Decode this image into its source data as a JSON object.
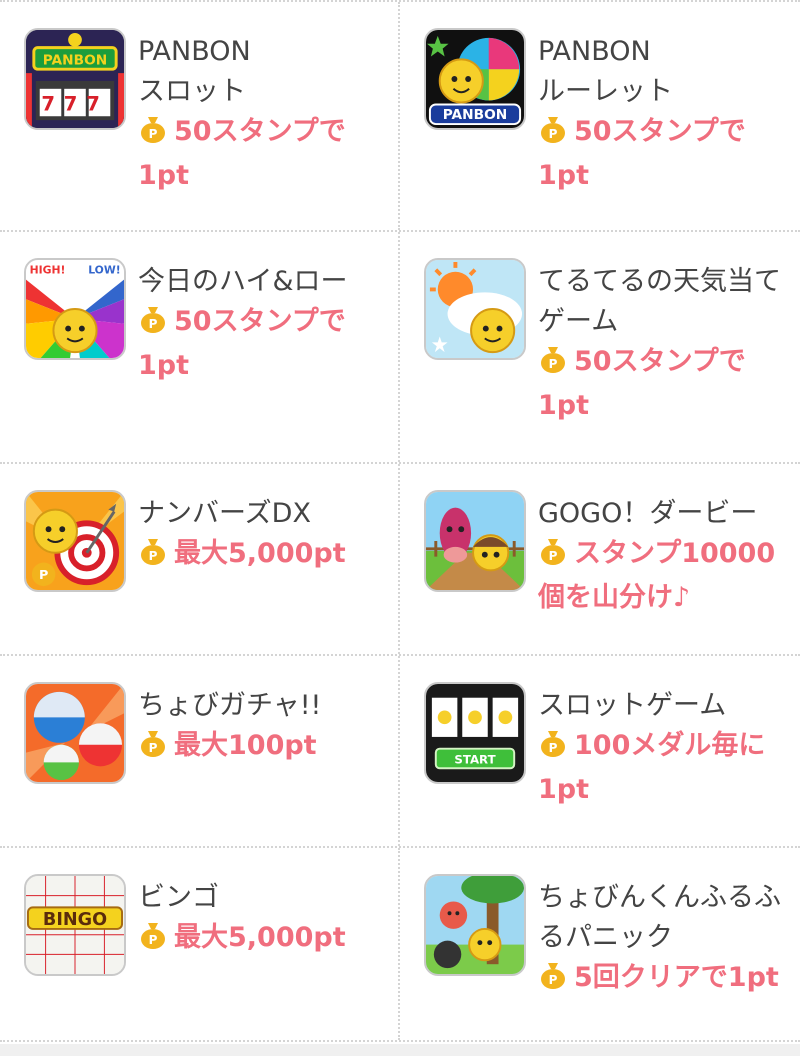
{
  "colors": {
    "title": "#444444",
    "reward": "#f06e7e",
    "bag": "#f2b31d"
  },
  "games": [
    {
      "title": "PANBON\nスロット",
      "reward": "50スタンプで1pt",
      "icon": "panbon-slot-icon"
    },
    {
      "title": "PANBON\nルーレット",
      "reward": "50スタンプで1pt",
      "icon": "panbon-roulette-icon"
    },
    {
      "title": "今日のハイ&ロー",
      "reward": "50スタンプで1pt",
      "icon": "high-low-icon"
    },
    {
      "title": "てるてるの天気当てゲーム",
      "reward": "50スタンプで1pt",
      "icon": "weather-game-icon"
    },
    {
      "title": "ナンバーズDX",
      "reward": "最大5,000pt",
      "icon": "numbers-dx-icon"
    },
    {
      "title": "GOGO！ダービー",
      "reward": "スタンプ10000個を山分け♪",
      "icon": "derby-icon"
    },
    {
      "title": "ちょびガチャ!!",
      "reward": "最大100pt",
      "icon": "gacha-icon"
    },
    {
      "title": "スロットゲーム",
      "reward": "100メダル毎に1pt",
      "icon": "slot-game-icon"
    },
    {
      "title": "ビンゴ",
      "reward": "最大5,000pt",
      "icon": "bingo-icon"
    },
    {
      "title": "ちょびんくんふるふるパニック",
      "reward": "5回クリアで1pt",
      "icon": "furufuru-panic-icon"
    }
  ],
  "icon_text": {
    "panbon": "PANBON",
    "slot_digits": "777",
    "high": "HIGH!",
    "low": "LOW!",
    "bingo": "BINGO",
    "start": "START"
  }
}
